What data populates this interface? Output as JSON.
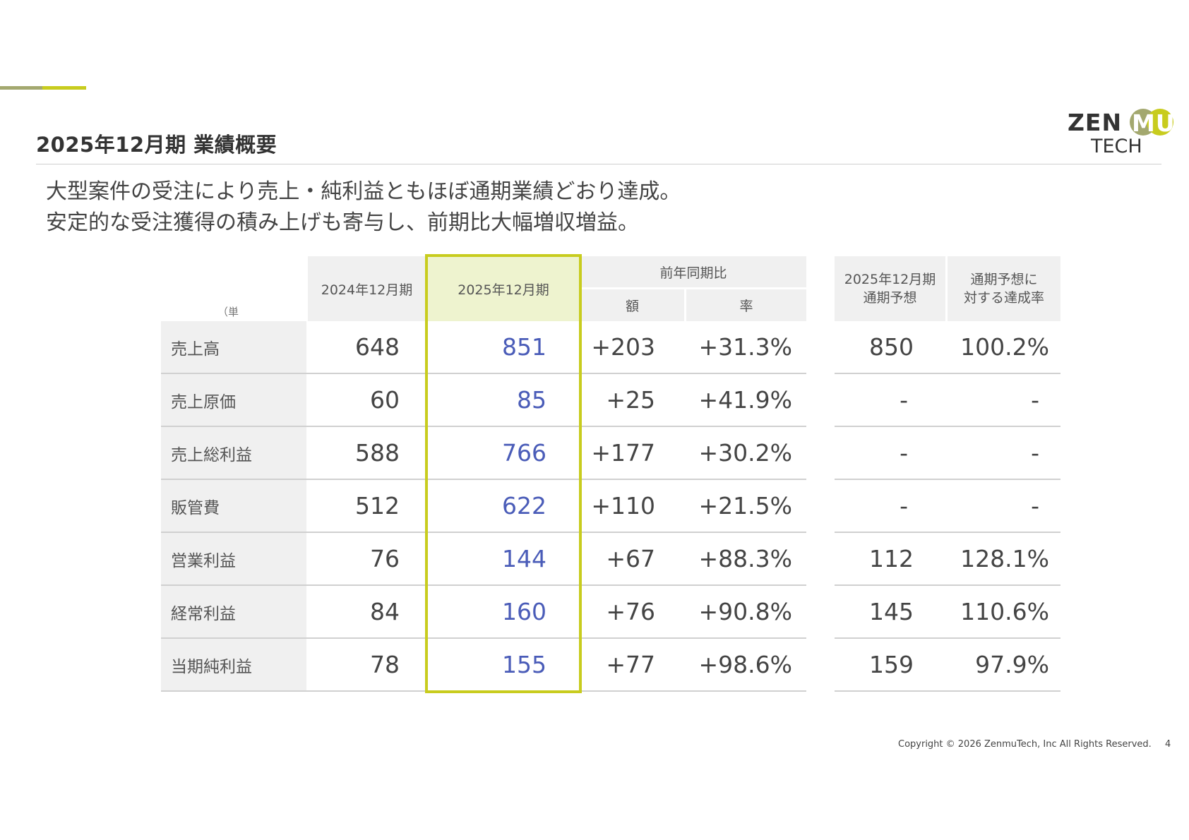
{
  "colors": {
    "accent_green": "#c8cc1e",
    "accent_olive": "#a3a86f",
    "value_blue": "#4a5cb8",
    "header_bg": "#f0f0f0",
    "highlight_bg": "#eef3cf"
  },
  "page": {
    "title": "2025年12月期 業績概要",
    "headline_line1": "大型案件の受注により売上・純利益ともほぼ通期業績どおり達成。",
    "headline_line2": "安定的な受注獲得の積み上げも寄与し、前期比大幅増収増益。"
  },
  "logo": {
    "top_left": "ZEN",
    "top_right": "MU",
    "bottom": "TECH"
  },
  "table": {
    "unit": "（単位：百万円）",
    "headers": {
      "fy2024": "2024年12月期",
      "fy2025": "2025年12月期",
      "yoy": "前年同期比",
      "yoy_amount": "額",
      "yoy_rate": "率",
      "forecast_line1": "2025年12月期",
      "forecast_line2": "通期予想",
      "achievement_line1": "通期予想に",
      "achievement_line2": "対する達成率"
    },
    "rows": [
      {
        "label": "売上高",
        "fy2024": "648",
        "fy2025": "851",
        "yoy_amount": "+203",
        "yoy_rate": "+31.3%",
        "forecast": "850",
        "achievement": "100.2%"
      },
      {
        "label": "売上原価",
        "fy2024": "60",
        "fy2025": "85",
        "yoy_amount": "+25",
        "yoy_rate": "+41.9%",
        "forecast": "-",
        "achievement": "-"
      },
      {
        "label": "売上総利益",
        "fy2024": "588",
        "fy2025": "766",
        "yoy_amount": "+177",
        "yoy_rate": "+30.2%",
        "forecast": "-",
        "achievement": "-"
      },
      {
        "label": "販管費",
        "fy2024": "512",
        "fy2025": "622",
        "yoy_amount": "+110",
        "yoy_rate": "+21.5%",
        "forecast": "-",
        "achievement": "-"
      },
      {
        "label": "営業利益",
        "fy2024": "76",
        "fy2025": "144",
        "yoy_amount": "+67",
        "yoy_rate": "+88.3%",
        "forecast": "112",
        "achievement": "128.1%"
      },
      {
        "label": "経常利益",
        "fy2024": "84",
        "fy2025": "160",
        "yoy_amount": "+76",
        "yoy_rate": "+90.8%",
        "forecast": "145",
        "achievement": "110.6%"
      },
      {
        "label": "当期純利益",
        "fy2024": "78",
        "fy2025": "155",
        "yoy_amount": "+77",
        "yoy_rate": "+98.6%",
        "forecast": "159",
        "achievement": "97.9%"
      }
    ]
  },
  "footer": {
    "copyright": "Copyright © 2026 ZenmuTech, Inc All Rights Reserved.",
    "page_number": "4"
  }
}
